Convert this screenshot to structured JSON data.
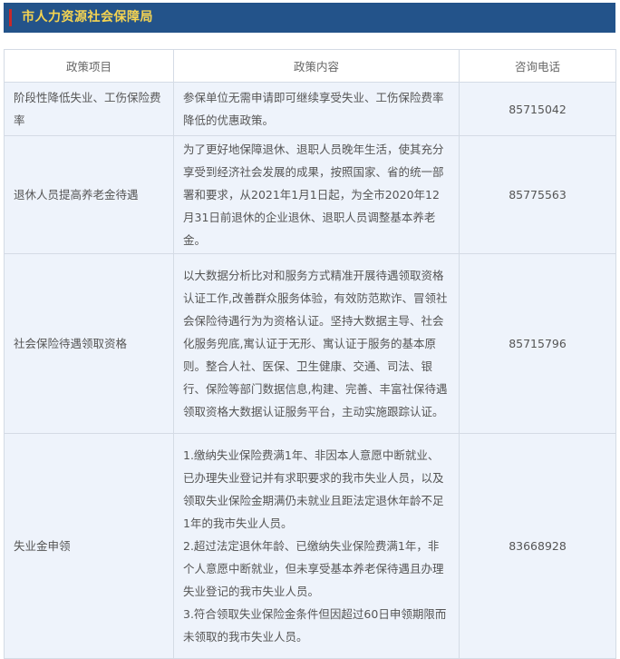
{
  "header": {
    "title": "市人力资源社会保障局",
    "background_color": "#23538a",
    "title_color": "#f5d451",
    "accent_bar_color": "#c8282a"
  },
  "table": {
    "columns": [
      "政策项目",
      "政策内容",
      "咨询电话"
    ],
    "rows": [
      {
        "item": "阶段性降低失业、工伤保险费率",
        "content": [
          "参保单位无需申请即可继续享受失业、工伤保险费率降低的优惠政策。"
        ],
        "phone": "85715042"
      },
      {
        "item": "退休人员提高养老金待遇",
        "content": [
          "为了更好地保障退休、退职人员晚年生活，使其充分享受到经济社会发展的成果，按照国家、省的统一部署和要求，从2021年1月1日起，为全市2020年12月31日前退休的企业退休、退职人员调整基本养老金。"
        ],
        "phone": "85775563"
      },
      {
        "item": "社会保险待遇领取资格",
        "content": [
          "以大数据分析比对和服务方式精准开展待遇领取资格认证工作,改善群众服务体验，有效防范欺诈、冒领社会保险待遇行为为资格认证。坚持大数据主导、社会化服务兜底,寓认证于无形、寓认证于服务的基本原则。整合人社、医保、卫生健康、交通、司法、银行、保险等部门数据信息,构建、完善、丰富社保待遇领取资格大数据认证服务平台，主动实施跟踪认证。"
        ],
        "phone": "85715796"
      },
      {
        "item": "失业金申领",
        "content": [
          "1.缴纳失业保险费满1年、非因本人意愿中断就业、已办理失业登记并有求职要求的我市失业人员，以及领取失业保险金期满仍未就业且距法定退休年龄不足1年的我市失业人员。",
          "2.超过法定退休年龄、已缴纳失业保险费满1年，非个人意愿中断就业，但未享受基本养老保待遇且办理失业登记的我市失业人员。",
          "3.符合领取失业保险金条件但因超过60日申领期限而未领取的我市失业人员。"
        ],
        "phone": "83668928"
      }
    ]
  }
}
